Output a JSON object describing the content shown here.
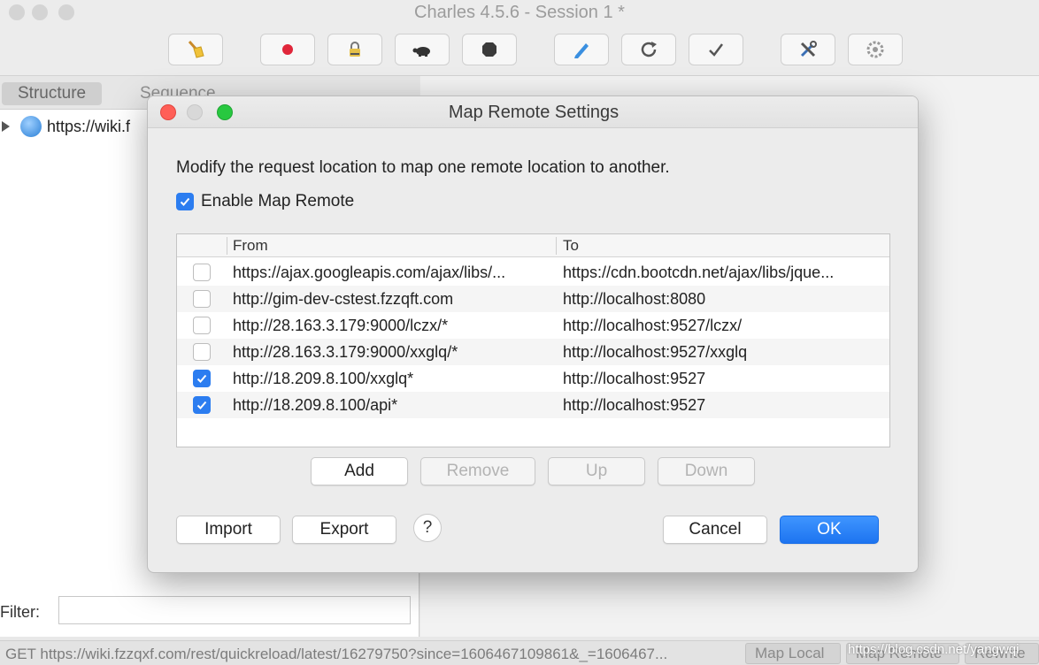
{
  "window": {
    "title": "Charles 4.5.6 - Session 1 *"
  },
  "toolbar": {
    "buttons": [
      {
        "icon": "broom-icon"
      },
      {
        "icon": "record-icon"
      },
      {
        "icon": "lock-icon"
      },
      {
        "icon": "turtle-icon"
      },
      {
        "icon": "stop-hexagon-icon"
      },
      {
        "icon": "pen-icon"
      },
      {
        "icon": "refresh-icon"
      },
      {
        "icon": "checkmark-icon"
      },
      {
        "icon": "tools-icon"
      },
      {
        "icon": "settings-gear-icon"
      }
    ]
  },
  "left_pane": {
    "tabs": [
      "Structure",
      "Sequence"
    ],
    "tree": [
      {
        "label": "https://wiki.f"
      }
    ]
  },
  "filter": {
    "label": "Filter:",
    "value": ""
  },
  "statusbar": {
    "text": "GET https://wiki.fzzqxf.com/rest/quickreload/latest/16279750?since=1606467109861&_=1606467...",
    "buttons": [
      "Map Local",
      "Map Remote",
      "Rewrite"
    ],
    "watermark": "https://blog.csdn.net/yangwqi"
  },
  "dialog": {
    "title": "Map Remote Settings",
    "description": "Modify the request location to map one remote location to another.",
    "enable_label": "Enable Map Remote",
    "enabled": true,
    "columns": [
      "From",
      "To"
    ],
    "rows": [
      {
        "checked": false,
        "from": "https://ajax.googleapis.com/ajax/libs/...",
        "to": "https://cdn.bootcdn.net/ajax/libs/jque..."
      },
      {
        "checked": false,
        "from": "http://gim-dev-cstest.fzzqft.com",
        "to": "http://localhost:8080"
      },
      {
        "checked": false,
        "from": "http://28.163.3.179:9000/lczx/*",
        "to": "http://localhost:9527/lczx/"
      },
      {
        "checked": false,
        "from": "http://28.163.3.179:9000/xxglq/*",
        "to": "http://localhost:9527/xxglq"
      },
      {
        "checked": true,
        "from": "http://18.209.8.100/xxglq*",
        "to": "http://localhost:9527"
      },
      {
        "checked": true,
        "from": "http://18.209.8.100/api*",
        "to": "http://localhost:9527"
      }
    ],
    "buttons": {
      "add": "Add",
      "remove": "Remove",
      "up": "Up",
      "down": "Down",
      "import": "Import",
      "export": "Export",
      "help": "?",
      "cancel": "Cancel",
      "ok": "OK"
    }
  }
}
